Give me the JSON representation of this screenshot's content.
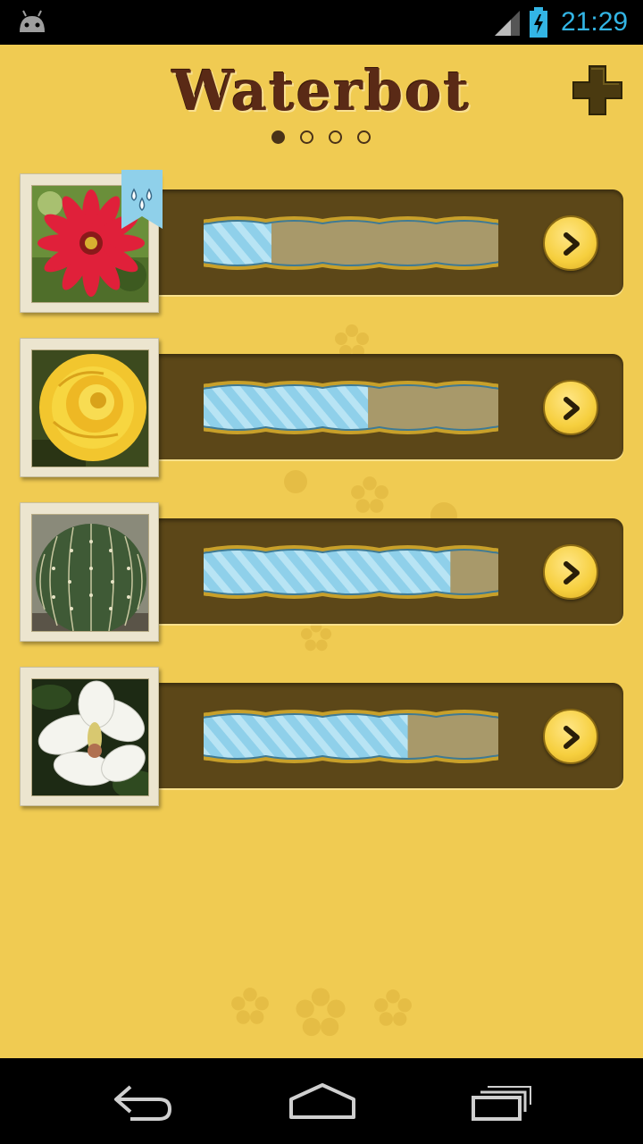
{
  "status_bar": {
    "time": "21:29"
  },
  "app": {
    "title": "Waterbot"
  },
  "pager": {
    "count": 4,
    "active_index": 0
  },
  "plants": [
    {
      "name": "red-flower",
      "water_level": 0.22,
      "needs_water": true
    },
    {
      "name": "yellow-rose",
      "water_level": 0.56,
      "needs_water": false
    },
    {
      "name": "barrel-cactus",
      "water_level": 0.85,
      "needs_water": false
    },
    {
      "name": "white-magnolia",
      "water_level": 0.7,
      "needs_water": false
    }
  ],
  "icons": {
    "add": "plus-icon",
    "detail": "chevron-right-icon",
    "needs_water": "water-drops-icon",
    "back": "back-icon",
    "home": "home-icon",
    "recents": "recent-apps-icon"
  },
  "colors": {
    "background": "#f0cb52",
    "panel": "#5c4718",
    "water": "#8fd0ea",
    "empty": "#a8996a",
    "accent_blue": "#33b5e5"
  }
}
